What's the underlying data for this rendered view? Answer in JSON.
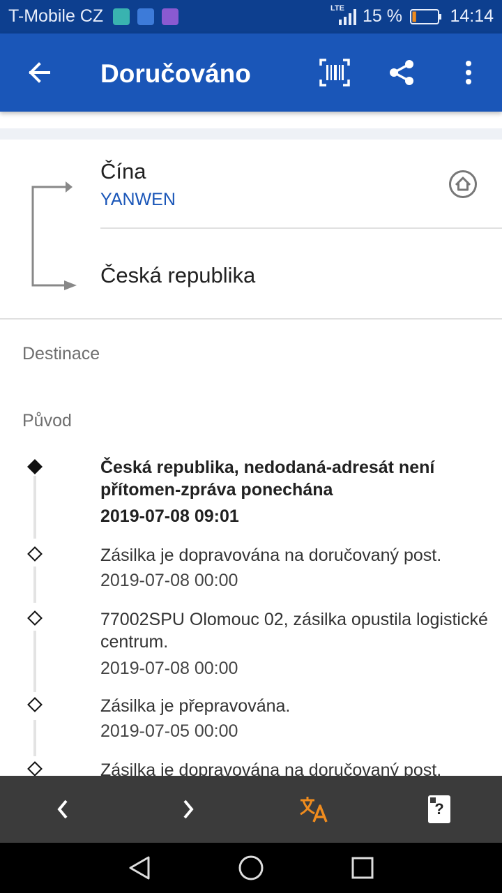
{
  "status_bar": {
    "carrier": "T-Mobile CZ",
    "network": "LTE",
    "battery_pct": "15 %",
    "battery_level": 0.15,
    "time": "14:14"
  },
  "appbar": {
    "title": "Doručováno",
    "icons": [
      "back-arrow-icon",
      "barcode-icon",
      "share-icon",
      "more-vert-icon"
    ]
  },
  "route": {
    "origin": "Čína",
    "carrier": "YANWEN",
    "destination": "Česká republika"
  },
  "sections": {
    "destination_label": "Destinace",
    "origin_label": "Původ"
  },
  "events": [
    {
      "text": "Česká republika, nedodaná-adresát není přítomen-zpráva ponechána",
      "date": "2019-07-08 09:01",
      "current": true
    },
    {
      "text": "Zásilka je dopravována na doručovaný post.",
      "date": "2019-07-08 00:00",
      "current": false
    },
    {
      "text": "77002SPU Olomouc 02, zásilka opustila logistické centrum.",
      "date": "2019-07-08 00:00",
      "current": false
    },
    {
      "text": "Zásilka je přepravována.",
      "date": "2019-07-05 00:00",
      "current": false
    },
    {
      "text": "Zásilka je dopravována na doručovaný post.",
      "date": "",
      "current": false
    }
  ],
  "bottom_toolbar": {
    "icons": [
      "chevron-left-icon",
      "chevron-right-icon",
      "translate-icon",
      "help-card-icon"
    ],
    "help_glyph": "?",
    "accent_color": "#f08c1e"
  },
  "nav_bar": {
    "icons": [
      "nav-back-icon",
      "nav-home-icon",
      "nav-recents-icon"
    ]
  },
  "colors": {
    "status_bar": "#0d3f8f",
    "appbar": "#1a56b8",
    "carrier_link": "#1a56b8"
  }
}
